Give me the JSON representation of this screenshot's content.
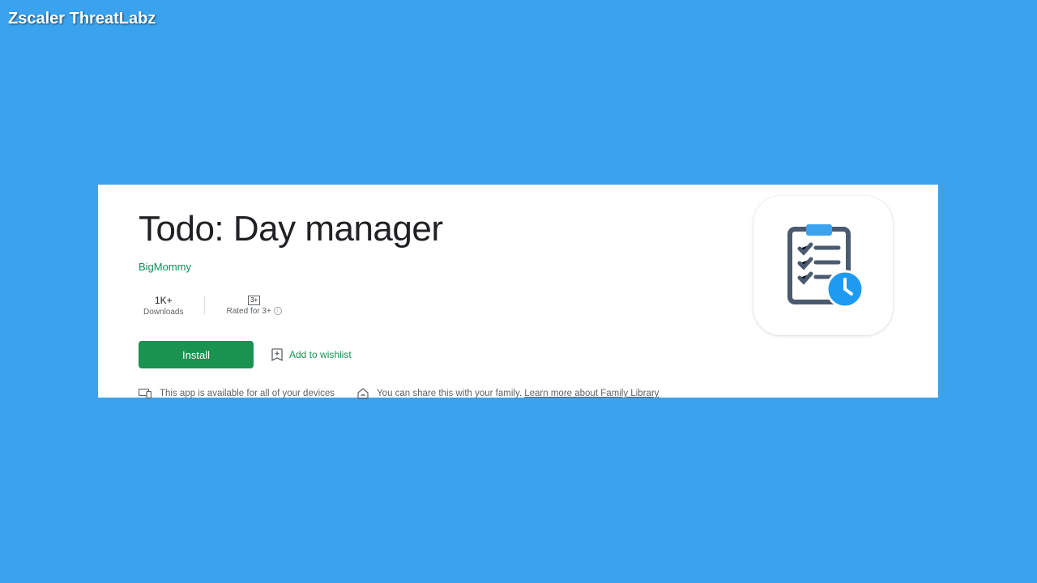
{
  "watermark": "Zscaler ThreatLabz",
  "app": {
    "title": "Todo: Day manager",
    "developer": "BigMommy",
    "stats": {
      "downloads_value": "1K+",
      "downloads_label": "Downloads",
      "rating_badge": "3+",
      "rating_label": "Rated for 3+"
    },
    "install_label": "Install",
    "wishlist_label": "Add to wishlist",
    "availability_text": "This app is available for all of your devices",
    "family_text": "You can share this with your family.",
    "family_link": "Learn more about Family Library"
  }
}
